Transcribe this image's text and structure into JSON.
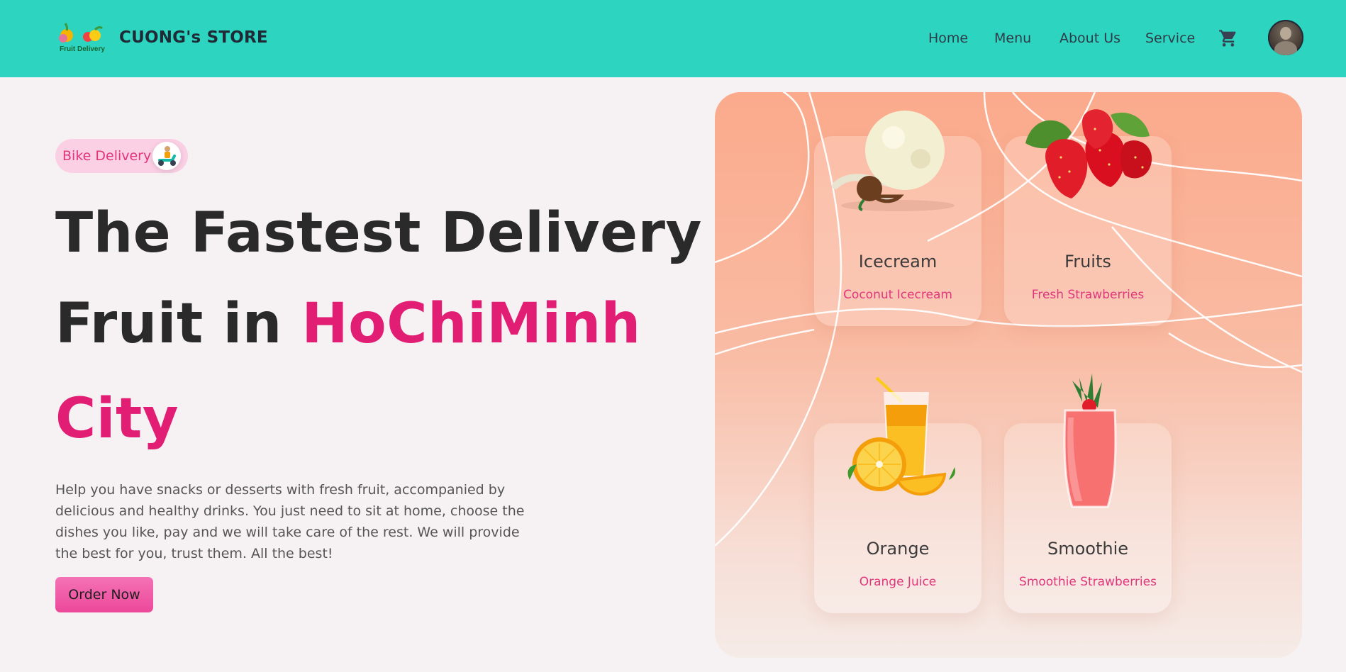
{
  "header": {
    "logo_text": "Fruit Delivery",
    "brand": "CUONG's STORE",
    "nav": {
      "home": "Home",
      "menu": "Menu",
      "about": "About Us",
      "service": "Service"
    },
    "cart_icon": "cart-icon",
    "avatar_icon": "user-avatar"
  },
  "hero": {
    "badge": "Bike Delivery",
    "headline_1": "The Fastest Delivery",
    "headline_2a": "Fruit in ",
    "headline_2b": "HoChiMinh",
    "headline_3": "City",
    "description": "Help you have snacks or desserts with fresh fruit, accompanied by delicious and healthy drinks. You just need to sit at home, choose the dishes you like, pay and we will take care of the rest. We will provide the best for you, trust them. All the best!",
    "order_button": "Order Now"
  },
  "cards": [
    {
      "title": "Icecream",
      "subtitle": "Coconut Icecream",
      "icon": "icecream-icon"
    },
    {
      "title": "Fruits",
      "subtitle": "Fresh Strawberries",
      "icon": "strawberry-icon"
    },
    {
      "title": "Orange",
      "subtitle": "Orange Juice",
      "icon": "orange-juice-icon"
    },
    {
      "title": "Smoothie",
      "subtitle": "Smoothie Strawberries",
      "icon": "smoothie-icon"
    }
  ],
  "colors": {
    "header_bg": "#2dd4bf",
    "accent_pink": "#e11d74",
    "button_pink": "#ec4899",
    "badge_bg": "#fbcfe4",
    "panel_top": "#fbaa8c"
  }
}
